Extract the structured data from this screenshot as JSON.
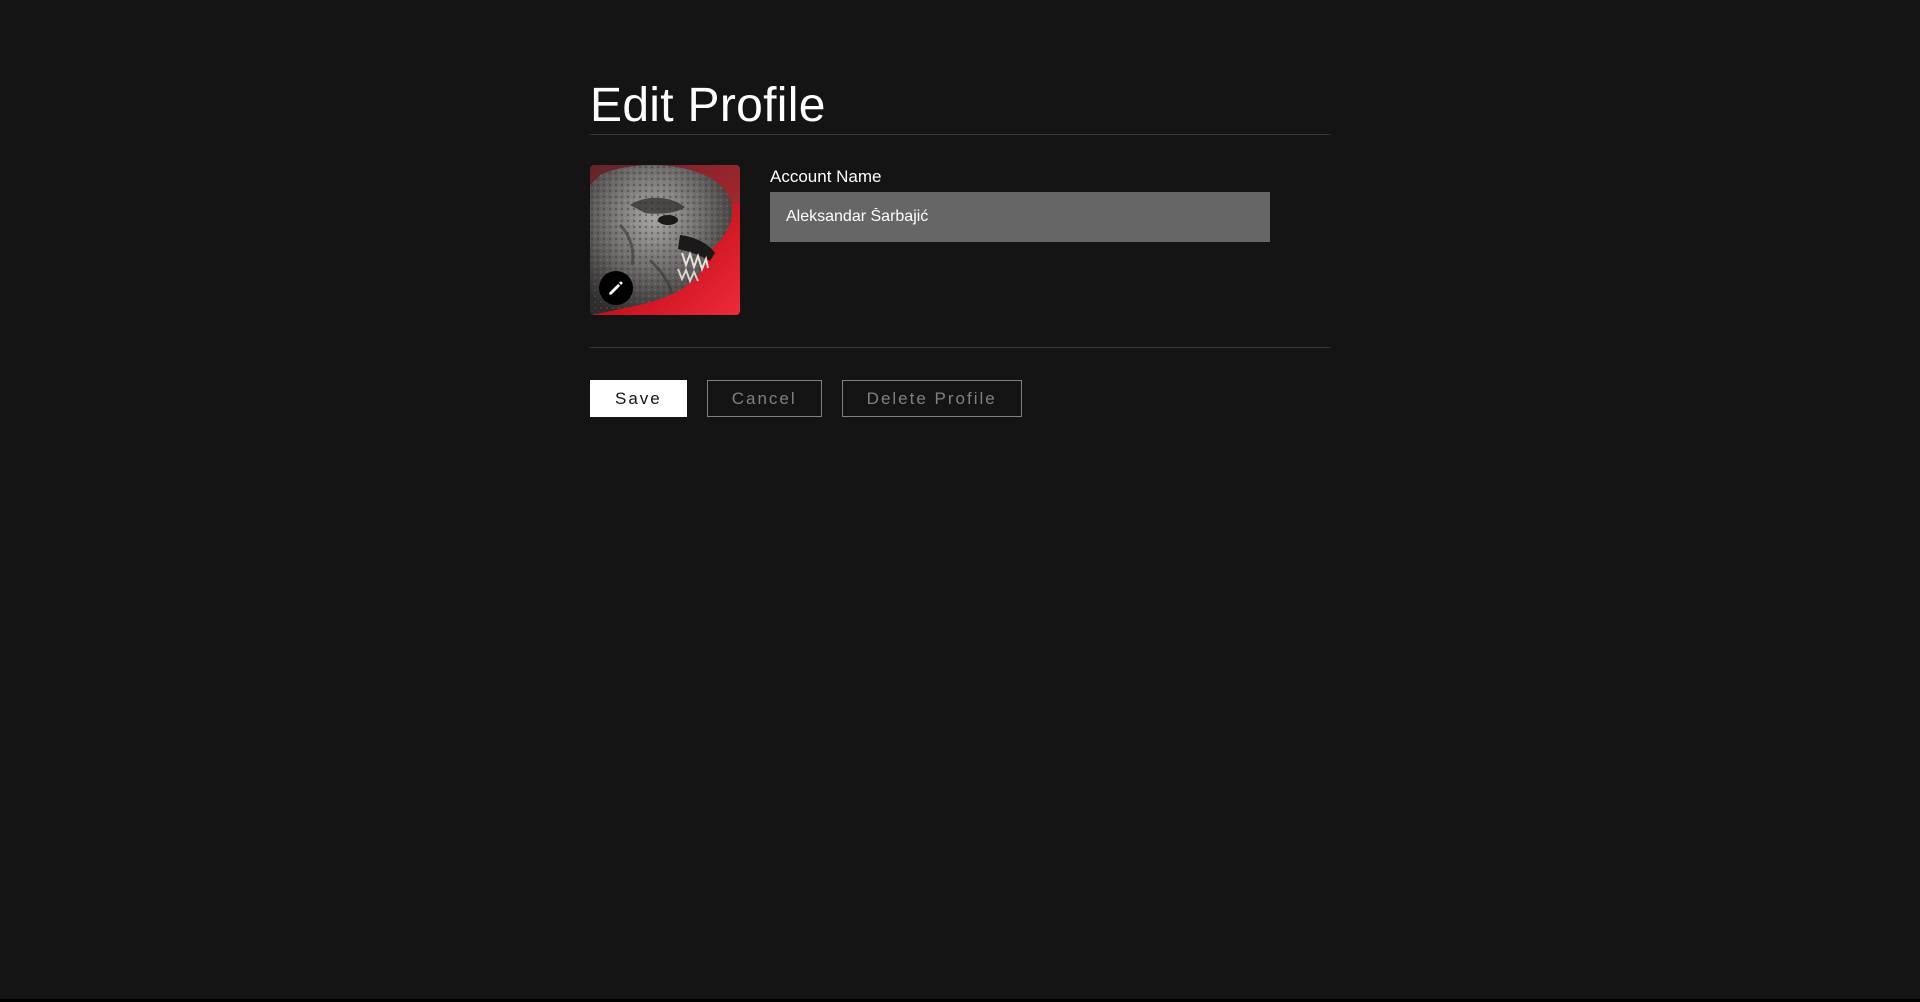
{
  "header": {
    "title": "Edit Profile"
  },
  "profile": {
    "avatar_icon": "monster-avatar-image",
    "edit_icon": "pencil-icon",
    "account_name_label": "Account Name",
    "account_name_value": "Aleksandar Šarbajić"
  },
  "actions": {
    "save_label": "Save",
    "cancel_label": "Cancel",
    "delete_label": "Delete Profile"
  },
  "colors": {
    "background": "#141414",
    "input_background": "#666666",
    "primary_button": "#ffffff",
    "secondary_text": "#808080",
    "avatar_accent": "#e21221"
  }
}
